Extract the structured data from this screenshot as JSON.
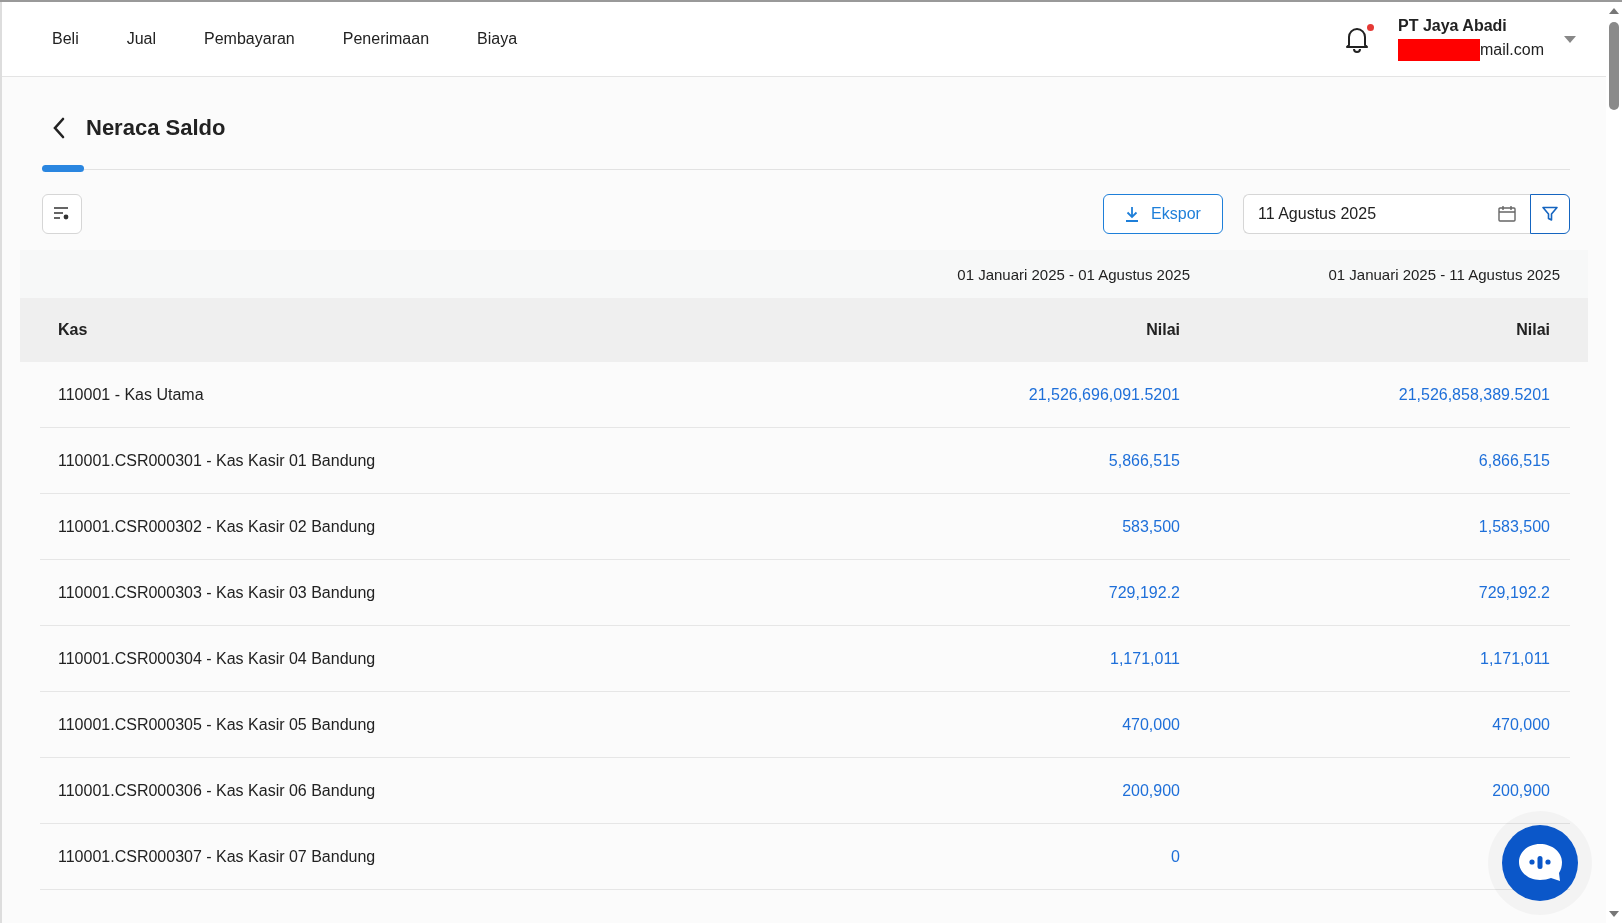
{
  "nav": [
    {
      "label": "Beli"
    },
    {
      "label": "Jual"
    },
    {
      "label": "Pembayaran"
    },
    {
      "label": "Penerimaan"
    },
    {
      "label": "Biaya"
    }
  ],
  "notifications": {
    "unread": true
  },
  "account": {
    "company": "PT Jaya Abadi",
    "email": "mail.com",
    "email_redacted": true
  },
  "page": {
    "title": "Neraca Saldo"
  },
  "toolbar": {
    "export_label": "Ekspor",
    "date": "11 Agustus 2025"
  },
  "table": {
    "periods": [
      "01 Januari 2025 - 01 Agustus 2025",
      "01 Januari 2025 - 11 Agustus 2025"
    ],
    "columns": [
      "Kas",
      "Nilai",
      "Nilai"
    ],
    "rows": [
      {
        "account": "110001 - Kas Utama",
        "values": [
          "21,526,696,091.5201",
          "21,526,858,389.5201"
        ]
      },
      {
        "account": "110001.CSR000301 - Kas Kasir 01 Bandung",
        "values": [
          "5,866,515",
          "6,866,515"
        ]
      },
      {
        "account": "110001.CSR000302 - Kas Kasir 02 Bandung",
        "values": [
          "583,500",
          "1,583,500"
        ]
      },
      {
        "account": "110001.CSR000303 - Kas Kasir 03 Bandung",
        "values": [
          "729,192.2",
          "729,192.2"
        ]
      },
      {
        "account": "110001.CSR000304 - Kas Kasir 04 Bandung",
        "values": [
          "1,171,011",
          "1,171,011"
        ]
      },
      {
        "account": "110001.CSR000305 - Kas Kasir 05 Bandung",
        "values": [
          "470,000",
          "470,000"
        ]
      },
      {
        "account": "110001.CSR000306 - Kas Kasir 06 Bandung",
        "values": [
          "200,900",
          "200,900"
        ]
      },
      {
        "account": "110001.CSR000307 - Kas Kasir 07 Bandung",
        "values": [
          "0"
        ]
      }
    ]
  }
}
